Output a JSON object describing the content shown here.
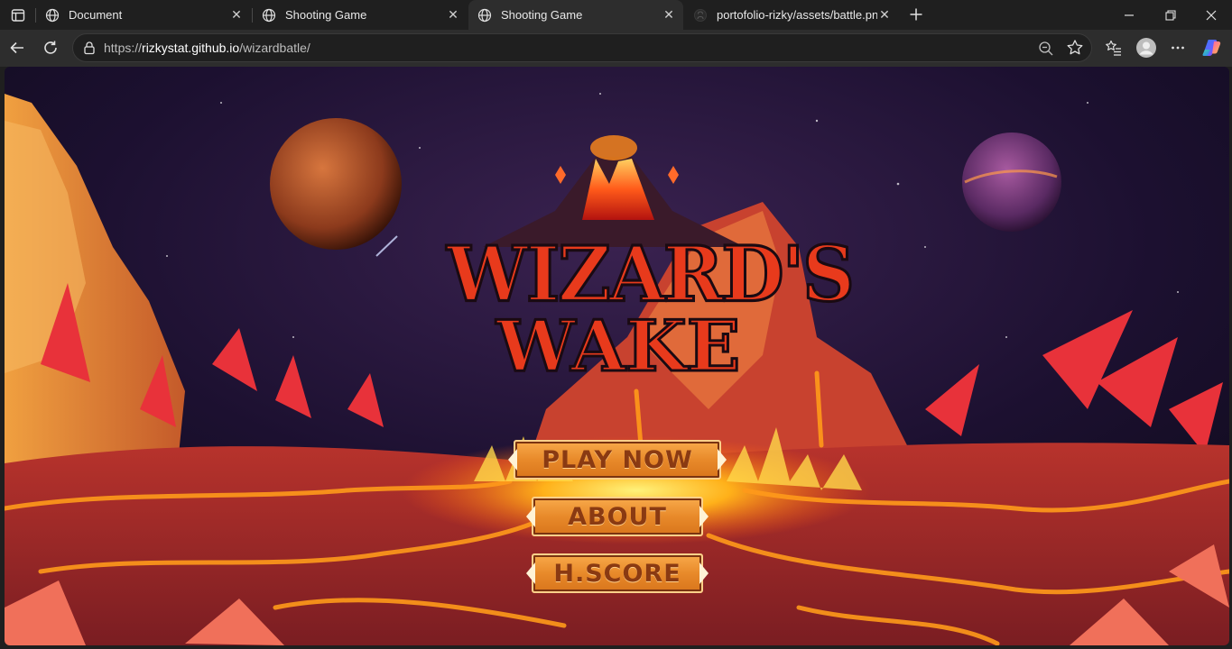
{
  "tabs": [
    {
      "title": "Document",
      "active": false
    },
    {
      "title": "Shooting Game",
      "active": false
    },
    {
      "title": "Shooting Game",
      "active": true
    },
    {
      "title": "portofolio-rizky/assets/battle.png",
      "active": false
    }
  ],
  "toolbar": {
    "url_prefix": "https://",
    "url_host": "rizkystat.github.io",
    "url_path": "/wizardbatle/"
  },
  "game": {
    "logo_line1": "WIZARD'S",
    "logo_line2": "WAKE",
    "buttons": {
      "play": "PLAY NOW",
      "about": "ABOUT",
      "highscore": "H.SCORE"
    }
  },
  "colors": {
    "tab_strip": "#1f1f1f",
    "toolbar": "#2d2d2d",
    "sky": "#1a0f2e",
    "lava": "#ff7a1a",
    "rock": "#c43a2a",
    "button": "#ef922f",
    "button_text": "#8a3a12"
  }
}
